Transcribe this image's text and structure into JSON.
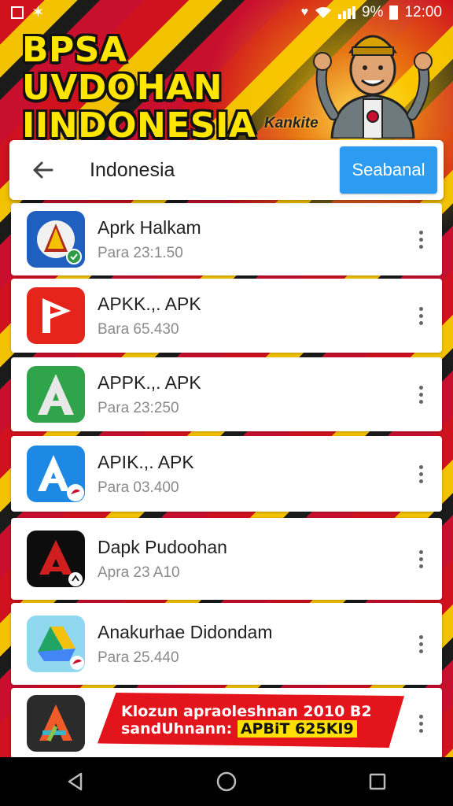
{
  "status_bar": {
    "time": "12:00",
    "signal_text": "9%",
    "icons": [
      "notification-icon",
      "star-icon",
      "location-icon",
      "wifi-icon",
      "signal-icon",
      "battery-icon"
    ]
  },
  "banner": {
    "title_line1": "BPSA UVDOHAN",
    "title_line2": "IINDONESIA",
    "caption": "Kankite"
  },
  "search": {
    "query": "Indonesia",
    "button_label": "Seabanal",
    "back_icon": "arrow-left-icon"
  },
  "results": [
    {
      "title": "Aprk Halkam",
      "subtitle": "Para 23:1.50"
    },
    {
      "title": "APKK.,. APK",
      "subtitle": "Bara 65.430"
    },
    {
      "title": "APPK.,. APK",
      "subtitle": "Para 23:250"
    },
    {
      "title": "APIK.,. APK",
      "subtitle": "Para 03.400"
    },
    {
      "title": "Dapk Pudoohan",
      "subtitle": "Apra 23 A10"
    },
    {
      "title": "Anakurhae Didondam",
      "subtitle": "Para 25.440"
    }
  ],
  "promo": {
    "line1": "Klozun apraoleshnan 2010 B2",
    "line2_prefix": "sandUhnann:",
    "line2_highlight": "APBiT 625KI9"
  },
  "colors": {
    "accent": "#2d9cf0",
    "banner_yellow": "#ffe600",
    "promo_red": "#e3141b"
  },
  "nav": [
    "back-triangle-icon",
    "home-circle-icon",
    "recents-square-icon"
  ]
}
